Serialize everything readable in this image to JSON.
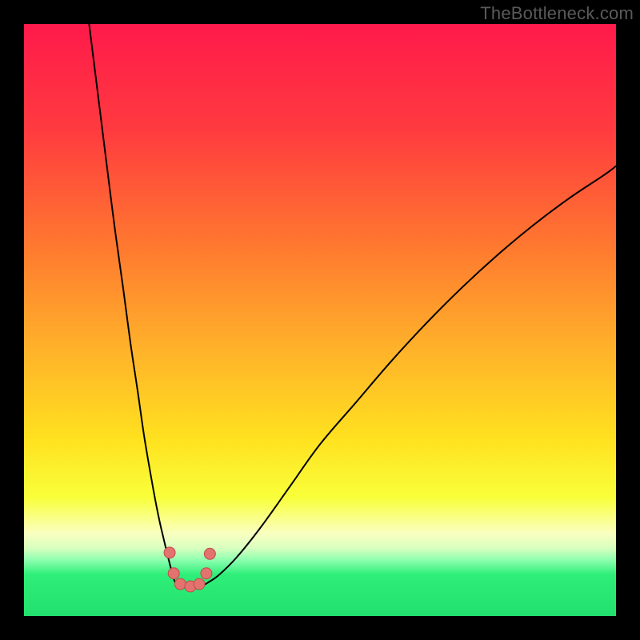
{
  "watermark": "TheBottleneck.com",
  "chart_data": {
    "type": "line",
    "title": "",
    "xlabel": "",
    "ylabel": "",
    "xlim": [
      0,
      100
    ],
    "ylim": [
      0,
      100
    ],
    "gradient_stops": [
      {
        "offset": 0.0,
        "color": "#ff1a4b"
      },
      {
        "offset": 0.18,
        "color": "#ff3b3f"
      },
      {
        "offset": 0.38,
        "color": "#ff7a2f"
      },
      {
        "offset": 0.55,
        "color": "#ffb22a"
      },
      {
        "offset": 0.7,
        "color": "#ffe11f"
      },
      {
        "offset": 0.8,
        "color": "#f9ff3a"
      },
      {
        "offset": 0.86,
        "color": "#faffc0"
      },
      {
        "offset": 0.885,
        "color": "#d9ffbf"
      },
      {
        "offset": 0.905,
        "color": "#8fffb0"
      },
      {
        "offset": 0.93,
        "color": "#2eef79"
      },
      {
        "offset": 1.0,
        "color": "#22e06d"
      }
    ],
    "series": [
      {
        "name": "left-branch",
        "x": [
          11.0,
          12.5,
          14.0,
          15.4,
          16.8,
          18.0,
          19.2,
          20.2,
          21.2,
          22.1,
          22.9,
          23.6,
          24.2,
          24.7,
          25.1,
          25.4,
          25.7,
          26.0
        ],
        "y": [
          100.0,
          88.0,
          76.0,
          65.0,
          55.0,
          46.0,
          38.0,
          31.0,
          25.0,
          20.0,
          16.0,
          13.0,
          10.5,
          8.5,
          7.0,
          6.0,
          5.4,
          5.0
        ]
      },
      {
        "name": "right-branch",
        "x": [
          30.0,
          31.0,
          33.0,
          36.0,
          40.0,
          45.0,
          50.0,
          56.0,
          62.0,
          68.0,
          74.0,
          80.0,
          86.0,
          92.0,
          98.0,
          100.0
        ],
        "y": [
          5.0,
          5.6,
          7.0,
          10.0,
          15.0,
          22.0,
          29.0,
          36.0,
          43.0,
          49.5,
          55.5,
          61.0,
          66.0,
          70.5,
          74.5,
          76.0
        ]
      },
      {
        "name": "valley-floor",
        "x": [
          26.0,
          27.0,
          28.0,
          29.0,
          30.0
        ],
        "y": [
          5.0,
          4.8,
          4.8,
          4.8,
          5.0
        ]
      }
    ],
    "markers": [
      {
        "x": 24.6,
        "y": 10.7
      },
      {
        "x": 25.3,
        "y": 7.2
      },
      {
        "x": 26.4,
        "y": 5.4
      },
      {
        "x": 28.1,
        "y": 5.0
      },
      {
        "x": 29.6,
        "y": 5.4
      },
      {
        "x": 30.8,
        "y": 7.2
      },
      {
        "x": 31.4,
        "y": 10.5
      }
    ],
    "marker_style": {
      "fill": "#e2736e",
      "stroke": "#c44b4b",
      "r": 7
    },
    "curve_style": {
      "stroke": "#000000",
      "width": 2
    }
  }
}
